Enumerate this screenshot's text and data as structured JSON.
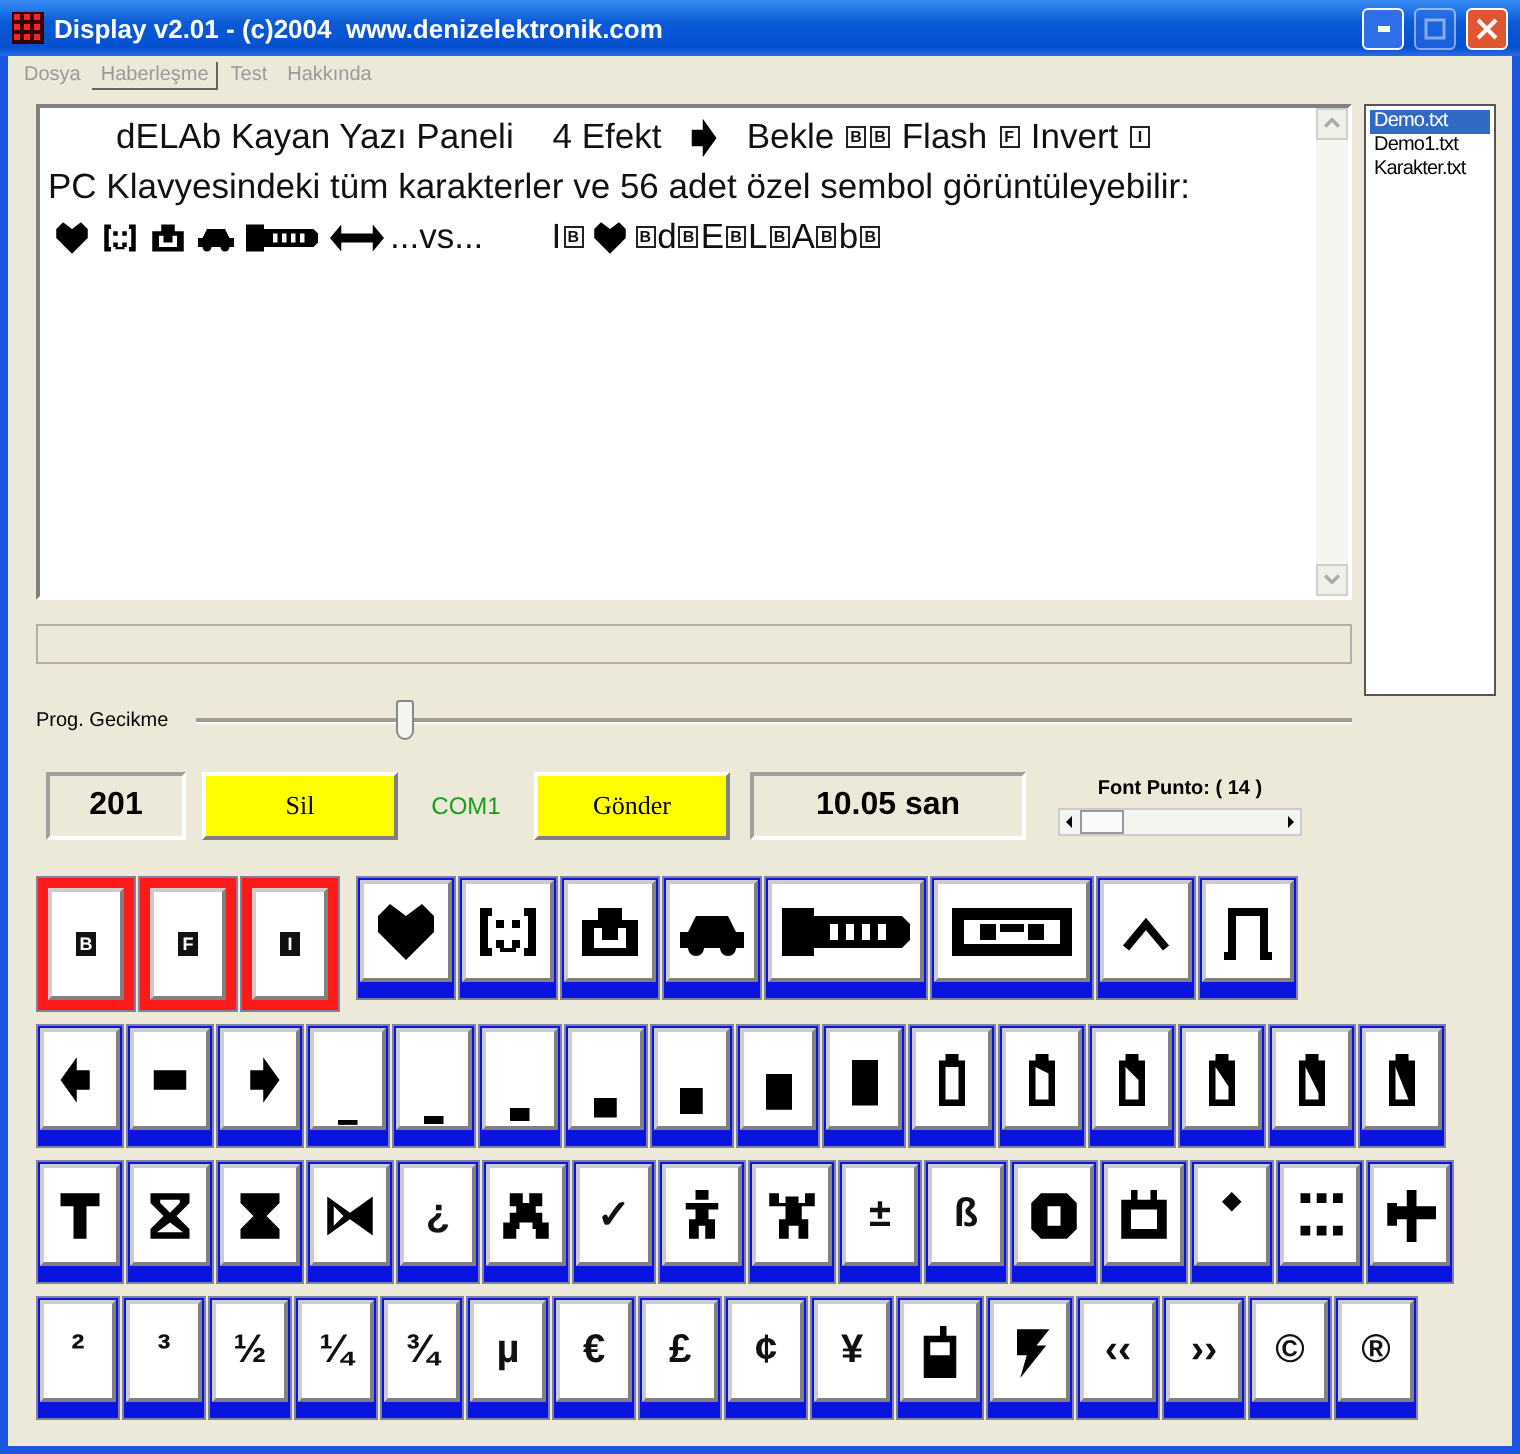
{
  "window": {
    "title": "Display v2.01 - (c)2004  www.denizelektronik.com"
  },
  "menu": [
    {
      "label": "Dosya",
      "selected": false
    },
    {
      "label": "Haberleşme",
      "selected": true
    },
    {
      "label": "Test",
      "selected": false
    },
    {
      "label": "Hakkında",
      "selected": false
    }
  ],
  "editor": {
    "lines": [
      [
        {
          "kind": "text",
          "text": "       dELAb Kayan Yazı Paneli    4 Efekt "
        },
        {
          "kind": "rightarrow"
        },
        {
          "kind": "text",
          "text": "  Bekle "
        },
        {
          "kind": "code",
          "text": "B"
        },
        {
          "kind": "code",
          "text": "B"
        },
        {
          "kind": "text",
          "text": " Flash "
        },
        {
          "kind": "code",
          "text": "F"
        },
        {
          "kind": "text",
          "text": " Invert "
        },
        {
          "kind": "code",
          "text": "I"
        }
      ],
      [
        {
          "kind": "text",
          "text": "PC Klavyesindeki tüm karakterler ve 56 adet özel sembol görüntüleyebilir:"
        }
      ],
      [
        {
          "kind": "heart"
        },
        {
          "kind": "face"
        },
        {
          "kind": "robot"
        },
        {
          "kind": "car"
        },
        {
          "kind": "plug"
        },
        {
          "kind": "doublearrow"
        },
        {
          "kind": "text",
          "text": "...vs...       I"
        },
        {
          "kind": "code",
          "text": "B"
        },
        {
          "kind": "heart"
        },
        {
          "kind": "code",
          "text": "B"
        },
        {
          "kind": "text",
          "text": "d"
        },
        {
          "kind": "code",
          "text": "B"
        },
        {
          "kind": "text",
          "text": "E"
        },
        {
          "kind": "code",
          "text": "B"
        },
        {
          "kind": "text",
          "text": "L"
        },
        {
          "kind": "code",
          "text": "B"
        },
        {
          "kind": "text",
          "text": "A"
        },
        {
          "kind": "code",
          "text": "B"
        },
        {
          "kind": "text",
          "text": "b"
        },
        {
          "kind": "code",
          "text": "B"
        }
      ]
    ]
  },
  "files": [
    {
      "name": "Demo.txt",
      "selected": true
    },
    {
      "name": "Demo1.txt",
      "selected": false
    },
    {
      "name": "Karakter.txt",
      "selected": false
    }
  ],
  "delay": {
    "label": "Prog. Gecikme",
    "level": 0.18
  },
  "counter": "201",
  "clear_button": "Sil",
  "port": "COM1",
  "send_button": "Gönder",
  "duration": "10.05 san",
  "font_size": {
    "label": "Font Punto: ( 14 )",
    "level": 0.11
  },
  "effect_buttons": [
    {
      "text": "B"
    },
    {
      "text": "F"
    },
    {
      "text": "I"
    }
  ],
  "symbol_rows": [
    [
      {
        "kind": "heart"
      },
      {
        "kind": "face"
      },
      {
        "kind": "robot"
      },
      {
        "kind": "car"
      },
      {
        "kind": "plug"
      },
      {
        "kind": "cassette"
      },
      {
        "kind": "peak"
      },
      {
        "kind": "pulse"
      }
    ],
    [
      {
        "kind": "leftarrow"
      },
      {
        "kind": "dash"
      },
      {
        "kind": "rightarrow"
      },
      {
        "kind": "bar1"
      },
      {
        "kind": "bar2"
      },
      {
        "kind": "bar3"
      },
      {
        "kind": "bar4"
      },
      {
        "kind": "bar5"
      },
      {
        "kind": "bar6"
      },
      {
        "kind": "bar7"
      },
      {
        "kind": "battery1"
      },
      {
        "kind": "battery2"
      },
      {
        "kind": "battery3"
      },
      {
        "kind": "battery4"
      },
      {
        "kind": "battery5"
      },
      {
        "kind": "battery6"
      }
    ],
    [
      {
        "kind": "hammer"
      },
      {
        "kind": "hourglass"
      },
      {
        "kind": "sandglass"
      },
      {
        "kind": "bowtie"
      },
      {
        "kind": "char",
        "text": "¿"
      },
      {
        "kind": "xfigure"
      },
      {
        "kind": "char",
        "text": "✓"
      },
      {
        "kind": "person"
      },
      {
        "kind": "cheer"
      },
      {
        "kind": "char",
        "text": "±"
      },
      {
        "kind": "char",
        "text": "ß"
      },
      {
        "kind": "ring"
      },
      {
        "kind": "tv"
      },
      {
        "kind": "diamond"
      },
      {
        "kind": "dots"
      },
      {
        "kind": "plane"
      }
    ],
    [
      {
        "kind": "char",
        "text": "²"
      },
      {
        "kind": "char",
        "text": "³"
      },
      {
        "kind": "char",
        "text": "½"
      },
      {
        "kind": "char",
        "text": "¼"
      },
      {
        "kind": "char",
        "text": "¾"
      },
      {
        "kind": "char",
        "text": "µ"
      },
      {
        "kind": "char",
        "text": "€"
      },
      {
        "kind": "char",
        "text": "£"
      },
      {
        "kind": "char",
        "text": "¢"
      },
      {
        "kind": "char",
        "text": "¥"
      },
      {
        "kind": "phone"
      },
      {
        "kind": "lightning"
      },
      {
        "kind": "char",
        "text": "‹‹"
      },
      {
        "kind": "char",
        "text": "››"
      },
      {
        "kind": "char",
        "text": "©"
      },
      {
        "kind": "char",
        "text": "®"
      }
    ]
  ]
}
